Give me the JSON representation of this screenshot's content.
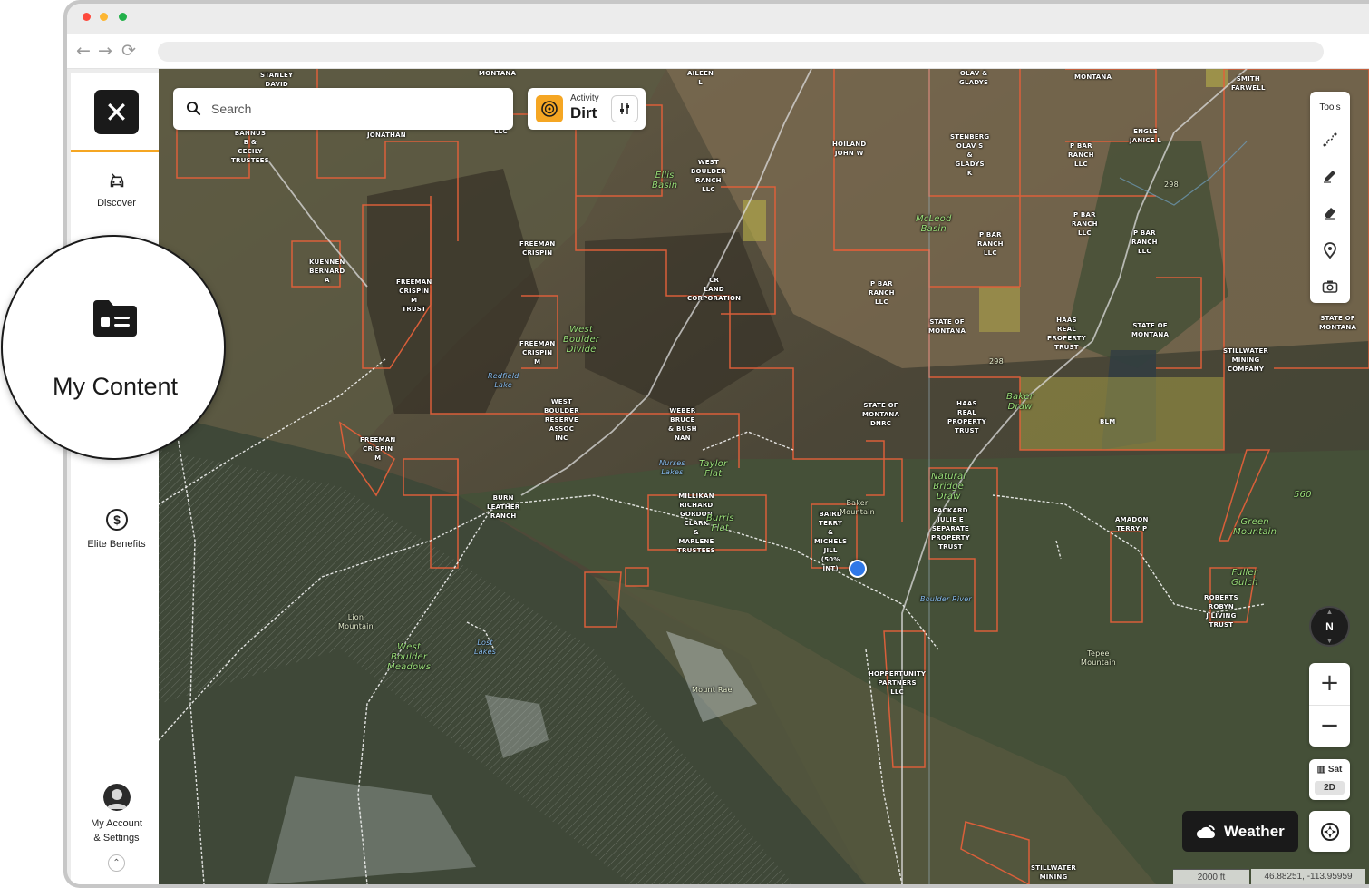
{
  "sidebar": {
    "discover_label": "Discover",
    "my_content_label": "My Content",
    "elite_benefits_label": "Elite Benefits",
    "account_label_line1": "My Account",
    "account_label_line2": "& Settings"
  },
  "search": {
    "placeholder": "Search"
  },
  "activity": {
    "label": "Activity",
    "value": "Dirt"
  },
  "tools": {
    "title": "Tools",
    "items": [
      "route-icon",
      "pencil-icon",
      "eraser-icon",
      "pin-icon",
      "camera-icon"
    ]
  },
  "compass": {
    "label": "N"
  },
  "zoom": {
    "in_label": "+",
    "out_label": "−"
  },
  "map_type": {
    "layer_label": "Sat",
    "mode_label": "2D"
  },
  "weather": {
    "label": "Weather"
  },
  "scale": {
    "label": "2000 ft"
  },
  "coords": {
    "label": "46.88251, -113.95959"
  },
  "colors": {
    "accent": "#f5a623",
    "parcel_border": "#e2603a",
    "location_dot": "#2f78e8"
  },
  "map_labels": [
    {
      "text": "STANLEY\nDAVID",
      "kind": "owner"
    },
    {
      "text": "MONTANA",
      "kind": "owner"
    },
    {
      "text": "AILEEN\nL",
      "kind": "owner"
    },
    {
      "text": "OLAV &\nGLADYS",
      "kind": "owner"
    },
    {
      "text": "MONTANA",
      "kind": "owner"
    },
    {
      "text": "SMITH\nFARWELL",
      "kind": "owner"
    },
    {
      "text": "BANNUS\nB &\nCECILY\nTRUSTEES",
      "kind": "owner"
    },
    {
      "text": "JONATHAN",
      "kind": "owner"
    },
    {
      "text": "LLC",
      "kind": "owner"
    },
    {
      "text": "WEST\nBOULDER\nRANCH\nLLC",
      "kind": "owner"
    },
    {
      "text": "HOILAND\nJOHN W",
      "kind": "owner"
    },
    {
      "text": "STENBERG\nOLAV S\n&\nGLADYS\nK",
      "kind": "owner"
    },
    {
      "text": "P BAR\nRANCH\nLLC",
      "kind": "owner"
    },
    {
      "text": "ENGLE\nJANICE L",
      "kind": "owner"
    },
    {
      "text": "Ellis\nBasin",
      "kind": "place"
    },
    {
      "text": "McLeod\nBasin",
      "kind": "place"
    },
    {
      "text": "P BAR\nRANCH\nLLC",
      "kind": "owner"
    },
    {
      "text": "P BAR\nRANCH\nLLC",
      "kind": "owner"
    },
    {
      "text": "P BAR\nRANCH\nLLC",
      "kind": "owner"
    },
    {
      "text": "KUENNEN\nBERNARD\nA",
      "kind": "owner"
    },
    {
      "text": "FREEMAN\nCRISPIN",
      "kind": "owner"
    },
    {
      "text": "FREEMAN\nCRISPIN\nM\nTRUST",
      "kind": "owner"
    },
    {
      "text": "CR\nLAND\nCORPORATION",
      "kind": "owner"
    },
    {
      "text": "P BAR\nRANCH\nLLC",
      "kind": "owner"
    },
    {
      "text": "STATE OF\nMONTANA",
      "kind": "owner"
    },
    {
      "text": "HAAS\nREAL\nPROPERTY\nTRUST",
      "kind": "owner"
    },
    {
      "text": "STATE OF\nMONTANA",
      "kind": "owner"
    },
    {
      "text": "STILLWATER\nMINING\nCOMPANY",
      "kind": "owner"
    },
    {
      "text": "STATE OF\nMONTANA",
      "kind": "owner"
    },
    {
      "text": "West\nBoulder\nDivide",
      "kind": "place"
    },
    {
      "text": "FREEMAN\nCRISPIN\nM",
      "kind": "owner"
    },
    {
      "text": "Redfield\nLake",
      "kind": "water"
    },
    {
      "text": "WEST\nBOULDER\nRESERVE\nASSOC\nINC",
      "kind": "owner"
    },
    {
      "text": "WEBER\nBRUCE\n& BUSH\nNAN",
      "kind": "owner"
    },
    {
      "text": "STATE OF\nMONTANA\nDNRC",
      "kind": "owner"
    },
    {
      "text": "HAAS\nREAL\nPROPERTY\nTRUST",
      "kind": "owner"
    },
    {
      "text": "Baker\nDraw",
      "kind": "place"
    },
    {
      "text": "BLM",
      "kind": "owner"
    },
    {
      "text": "FREEMAN\nCRISPIN\nM",
      "kind": "owner"
    },
    {
      "text": "Taylor\nFlat",
      "kind": "place"
    },
    {
      "text": "Nurses\nLakes",
      "kind": "water"
    },
    {
      "text": "BURN\nLEATHER\nRANCH",
      "kind": "owner"
    },
    {
      "text": "MILLIKAN\nRICHARD\nGORDON\nCLARK\n&\nMARLENE\nTRUSTEES",
      "kind": "owner"
    },
    {
      "text": "Burris\nFlat",
      "kind": "place"
    },
    {
      "text": "BAIRD\nTERRY\n&\nMICHELS\nJILL\n(50%\nINT)",
      "kind": "owner"
    },
    {
      "text": "Baker\nMountain",
      "kind": "feature"
    },
    {
      "text": "Natural\nBridge\nDraw",
      "kind": "place"
    },
    {
      "text": "PACKARD\nJULIE E\nSEPARATE\nPROPERTY\nTRUST",
      "kind": "owner"
    },
    {
      "text": "Green\nMountain",
      "kind": "place"
    },
    {
      "text": "AMADON\nTERRY P",
      "kind": "owner"
    },
    {
      "text": "Lion\nMountain",
      "kind": "feature"
    },
    {
      "text": "West\nBoulder\nMeadows",
      "kind": "place"
    },
    {
      "text": "Lost\nLakes",
      "kind": "water"
    },
    {
      "text": "Mount Rae",
      "kind": "feature"
    },
    {
      "text": "HOPPERTUNITY\nPARTNERS\nLLC",
      "kind": "owner"
    },
    {
      "text": "Tepee\nMountain",
      "kind": "feature"
    },
    {
      "text": "ROBERTS\nROBYN\nJ LIVING\nTRUST",
      "kind": "owner"
    },
    {
      "text": "Fuller\nGulch",
      "kind": "place"
    },
    {
      "text": "Boulder River",
      "kind": "water"
    },
    {
      "text": "STILLWATER\nMINING",
      "kind": "owner"
    },
    {
      "text": "560",
      "kind": "place"
    },
    {
      "text": "298",
      "kind": "feature"
    },
    {
      "text": "298",
      "kind": "feature"
    }
  ]
}
